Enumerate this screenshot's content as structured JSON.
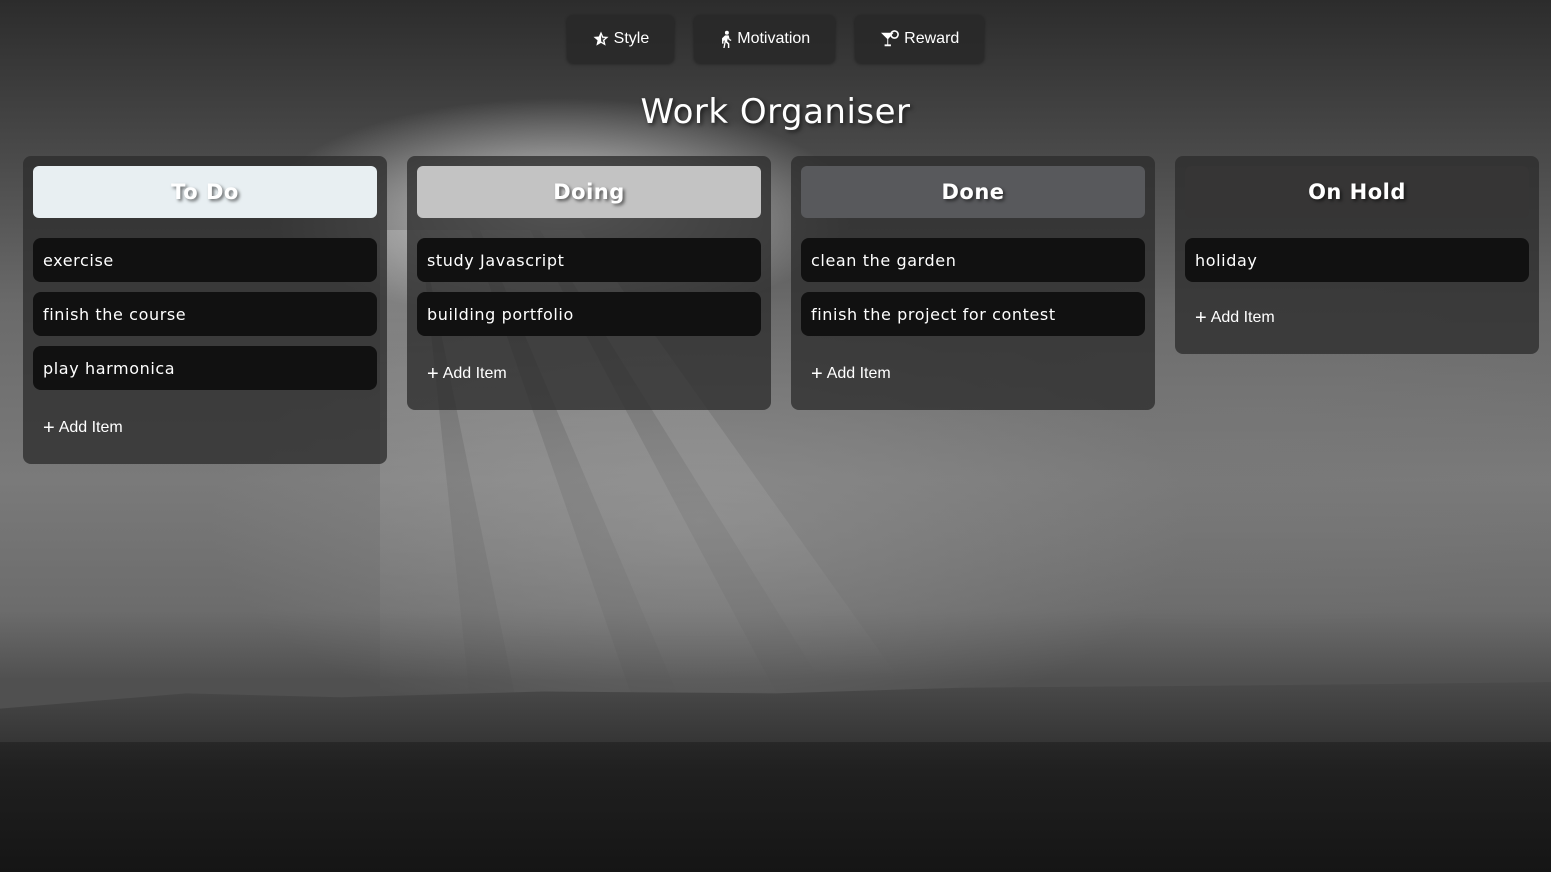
{
  "nav": {
    "buttons": [
      {
        "label": "Style",
        "icon": "star-icon"
      },
      {
        "label": "Motivation",
        "icon": "running-person-icon"
      },
      {
        "label": "Reward",
        "icon": "cocktail-icon"
      }
    ]
  },
  "title": "Work Organiser",
  "columns": [
    {
      "header": "To Do",
      "header_color": "#e8eff2",
      "items": [
        "exercise",
        "finish the course",
        "play harmonica"
      ],
      "add_label": "Add Item"
    },
    {
      "header": "Doing",
      "header_color": "#c3c3c3",
      "items": [
        "study Javascript",
        "building portfolio"
      ],
      "add_label": "Add Item"
    },
    {
      "header": "Done",
      "header_color": "#58595c",
      "items": [
        "clean the garden",
        "finish the project for contest"
      ],
      "add_label": "Add Item"
    },
    {
      "header": "On Hold",
      "header_color": "#363535",
      "items": [
        "holiday"
      ],
      "add_label": "Add Item"
    }
  ]
}
